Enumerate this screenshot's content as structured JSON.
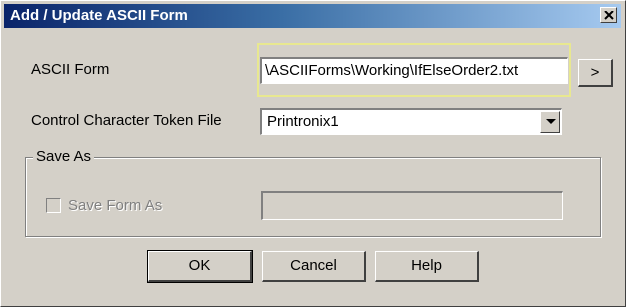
{
  "window": {
    "title": "Add / Update ASCII Form",
    "close_glyph": "close-icon"
  },
  "ascii_form": {
    "label": "ASCII Form",
    "value": "\\ASCIIForms\\Working\\IfElseOrder2.txt",
    "browse_label": ">"
  },
  "token_file": {
    "label": "Control Character Token File",
    "selected": "Printronix1",
    "arrow_icon": "chevron-down-icon"
  },
  "save_as": {
    "group_label": "Save As",
    "checkbox_label": "Save Form As",
    "checked": false,
    "value": ""
  },
  "buttons": {
    "ok": "OK",
    "cancel": "Cancel",
    "help": "Help"
  },
  "colors": {
    "titlebar_start": "#0a246a",
    "titlebar_end": "#a6caf0",
    "face": "#d4d0c8"
  }
}
